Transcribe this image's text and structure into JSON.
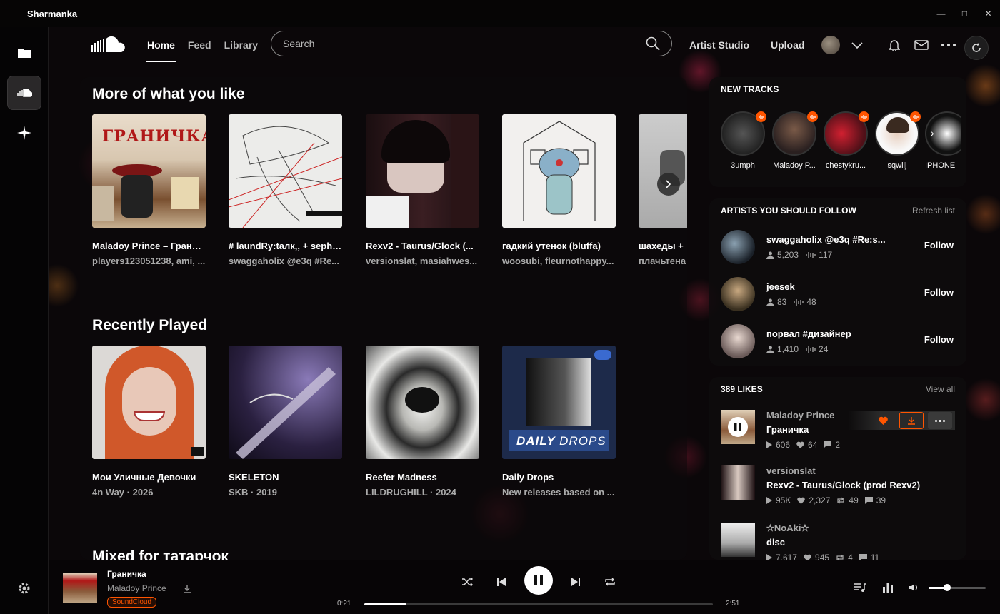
{
  "window": {
    "title": "Sharmanka"
  },
  "nav": {
    "home": "Home",
    "feed": "Feed",
    "library": "Library",
    "search_placeholder": "Search",
    "artist_studio": "Artist Studio",
    "upload": "Upload"
  },
  "sections": {
    "more_title": "More of what you like",
    "recent_title": "Recently Played",
    "mixed_title": "Mixed for татарчок"
  },
  "more_cards": [
    {
      "title": "Maladoy Prince – Граничка",
      "sub": "players123051238, ami, ...",
      "art_text": "ГРАНИЧКА"
    },
    {
      "title": "# laundRy:taлк,, + seph ...",
      "sub": "swaggaholix @e3q #Re..."
    },
    {
      "title": "Rexv2 - Taurus/Glock (...",
      "sub": "versionslat, masiahwes..."
    },
    {
      "title": "гадкий утенок (bluffa)",
      "sub": "woosubi, fleurnothappy..."
    },
    {
      "title": "шахеды +",
      "sub": "плачьтена"
    }
  ],
  "recent_cards": [
    {
      "title": "Мои Уличные Девочки",
      "sub": "4n Way · 2026"
    },
    {
      "title": "SKELETON",
      "sub": "SKB · 2019"
    },
    {
      "title": "Reefer Madness",
      "sub": "LILDRUGHILL · 2024"
    },
    {
      "title": "Daily Drops",
      "sub": "New releases based on ...",
      "art_text_a": "DAILY",
      "art_text_b": "DROPS"
    }
  ],
  "new_tracks": {
    "heading": "NEW TRACKS",
    "items": [
      {
        "name": "3umph"
      },
      {
        "name": "Maladoy P..."
      },
      {
        "name": "chestykru..."
      },
      {
        "name": "sqwiij"
      },
      {
        "name": "IPHONE"
      }
    ]
  },
  "artists": {
    "heading": "ARTISTS YOU SHOULD FOLLOW",
    "refresh": "Refresh list",
    "follow_label": "Follow",
    "items": [
      {
        "name": "swaggaholix @e3q #Re:s...",
        "followers": "5,203",
        "tracks": "117"
      },
      {
        "name": "jeesek",
        "followers": "83",
        "tracks": "48"
      },
      {
        "name": "порвал #дизайнер",
        "followers": "1,410",
        "tracks": "24"
      }
    ]
  },
  "likes": {
    "heading": "389 LIKES",
    "view_all": "View all",
    "items": [
      {
        "artist": "Maladoy Prince",
        "title": "Граничка",
        "plays": "606",
        "likes": "64",
        "reposts": "",
        "comments": "2"
      },
      {
        "artist": "versionslat",
        "title": "Rexv2 - Taurus/Glock (prod Rexv2)",
        "plays": "95K",
        "likes": "2,327",
        "reposts": "49",
        "comments": "39"
      },
      {
        "artist": "✫NoAki✫",
        "title": "disc",
        "plays": "7,617",
        "likes": "945",
        "reposts": "4",
        "comments": "11"
      }
    ]
  },
  "player": {
    "title": "Граничка",
    "artist": "Maladoy Prince",
    "source": "SoundCloud",
    "elapsed": "0:21",
    "duration": "2:51",
    "progress": 0.12,
    "volume": 0.33
  },
  "colors": {
    "accent": "#ff5500",
    "background": "#0b0709"
  }
}
